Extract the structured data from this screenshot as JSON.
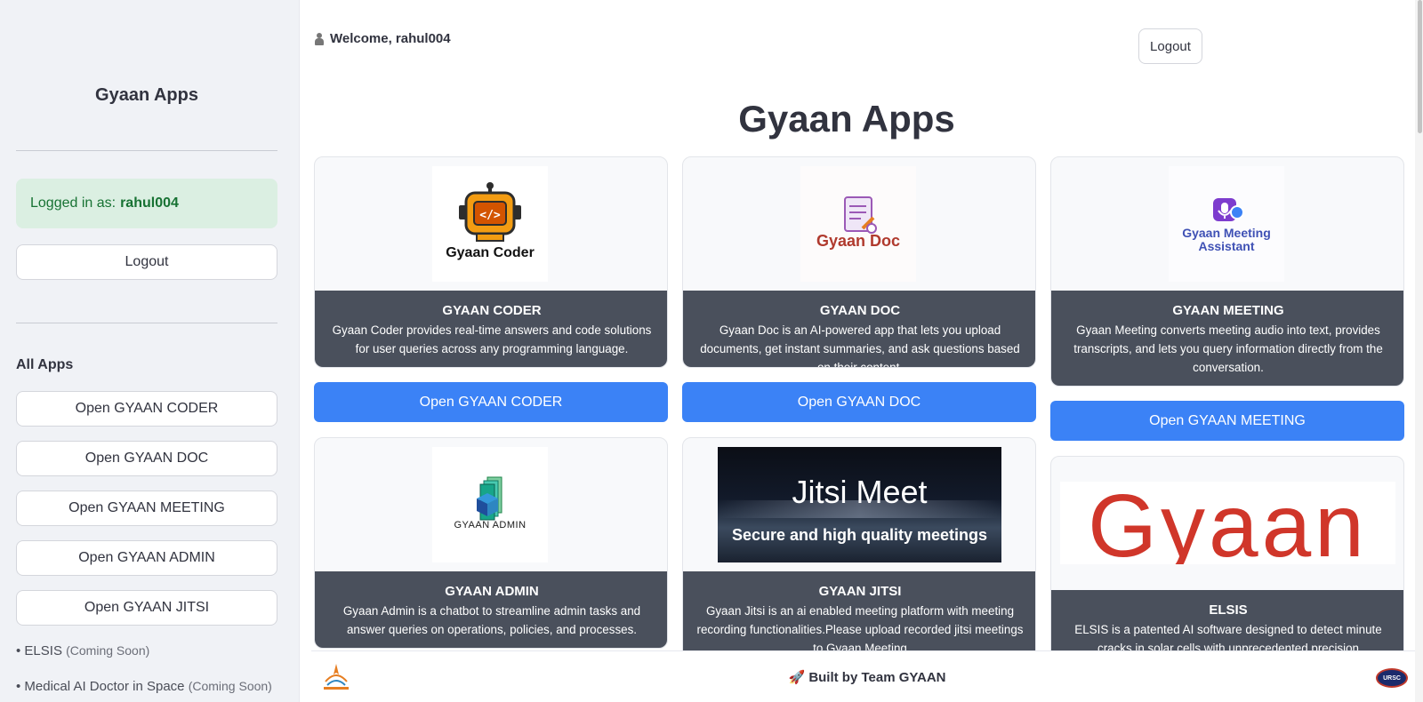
{
  "sidebar": {
    "title": "Gyaan Apps",
    "login_prefix": "Logged in as:",
    "username": "rahul004",
    "logout_label": "Logout",
    "section_label": "All Apps",
    "app_buttons": [
      "Open GYAAN CODER",
      "Open GYAAN DOC",
      "Open GYAAN MEETING",
      "Open GYAAN ADMIN",
      "Open GYAAN JITSI"
    ],
    "coming_soon": [
      {
        "name": "• ELSIS",
        "tag": "(Coming Soon)"
      },
      {
        "name": "• Medical AI Doctor in Space",
        "tag": "(Coming Soon)"
      }
    ]
  },
  "header": {
    "welcome": "Welcome, rahul004",
    "logout_label": "Logout"
  },
  "main": {
    "title": "Gyaan Apps",
    "cards": [
      {
        "logo_text": "Gyaan Coder",
        "name": "GYAAN CODER",
        "desc": "Gyaan Coder provides real-time answers and code solutions for user queries across any programming language.",
        "button": "Open GYAAN CODER"
      },
      {
        "logo_text": "Gyaan Doc",
        "name": "GYAAN DOC",
        "desc": "Gyaan Doc is an AI-powered app that lets you upload documents, get instant summaries, and ask questions based on their content.",
        "button": "Open GYAAN DOC"
      },
      {
        "logo_text": "Gyaan Meeting Assistant",
        "name": "GYAAN MEETING",
        "desc": "Gyaan Meeting converts meeting audio into text, provides transcripts, and lets you query information directly from the conversation.",
        "button": "Open GYAAN MEETING"
      },
      {
        "logo_text": "GYAAN ADMIN",
        "name": "GYAAN ADMIN",
        "desc": "Gyaan Admin is a chatbot to streamline admin tasks and answer queries on operations, policies, and processes."
      },
      {
        "logo_title": "Jitsi Meet",
        "logo_sub": "Secure and high quality meetings",
        "name": "GYAAN JITSI",
        "desc": "Gyaan Jitsi is an ai enabled meeting platform with meeting recording functionalities.Please upload recorded jitsi meetings to Gyaan Meeting"
      },
      {
        "logo_text": "Gyaan",
        "name": "ELSIS",
        "desc": "ELSIS is a patented AI software designed to detect minute cracks in solar cells with unprecedented precision"
      }
    ]
  },
  "footer": {
    "text": "🚀 Built by Team GYAAN",
    "right_logo_text": "URSC"
  },
  "colors": {
    "primary_button": "#3b82f6",
    "card_body": "#4a505c",
    "sidebar_bg": "#f0f2f6",
    "success_bg": "#dbefe2",
    "success_text": "#177233"
  }
}
